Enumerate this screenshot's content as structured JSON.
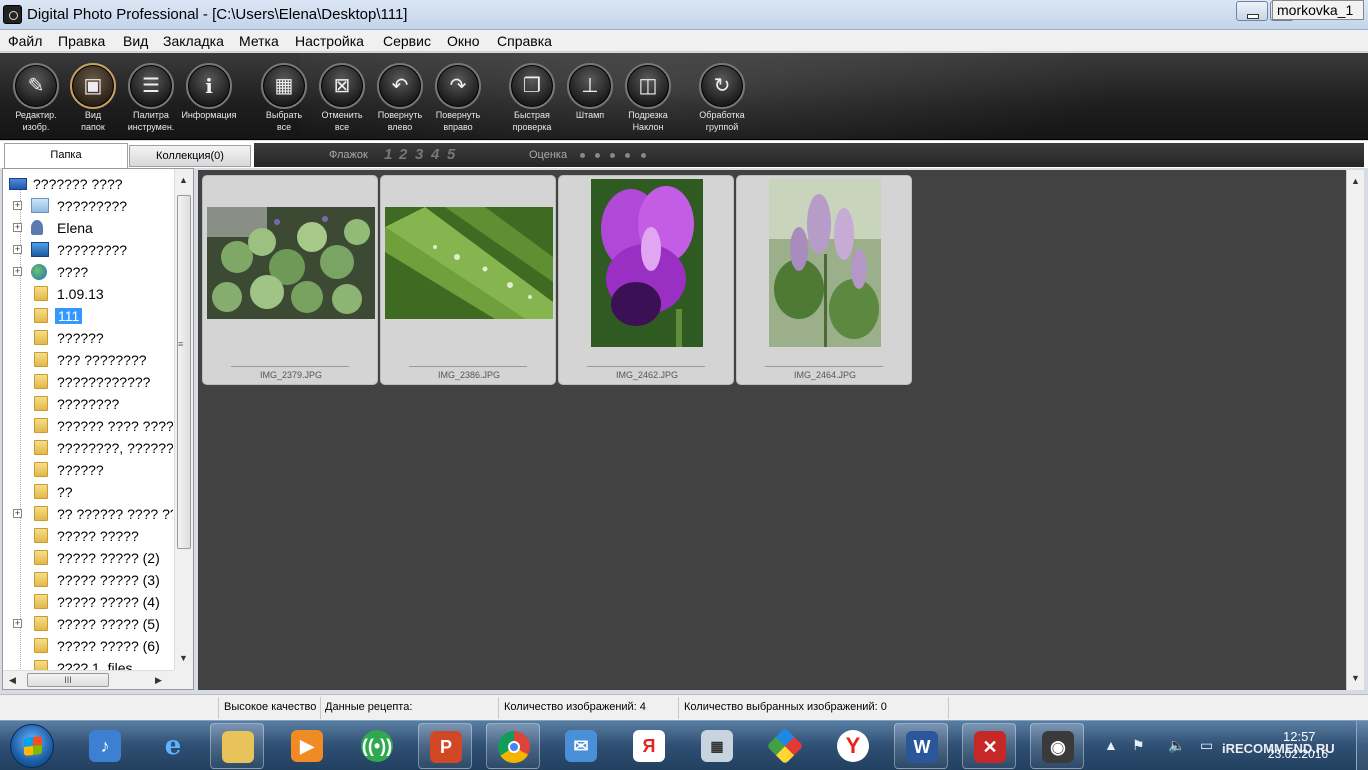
{
  "window": {
    "title": "Digital Photo Professional - [C:\\Users\\Elena\\Desktop\\111]",
    "user_badge": "morkovka_1"
  },
  "menu": [
    "Файл",
    "Правка",
    "Вид",
    "Закладка",
    "Метка",
    "Настройка",
    "Сервис",
    "Окно",
    "Справка"
  ],
  "toolbar": {
    "buttons": [
      {
        "line1": "Редактир.",
        "line2": "изобр.",
        "icon": "edit-image-icon"
      },
      {
        "line1": "Вид",
        "line2": "папок",
        "icon": "folder-view-icon"
      },
      {
        "line1": "Палитра",
        "line2": "инструмен.",
        "icon": "tool-palette-icon"
      },
      {
        "line1": "Информация",
        "line2": "",
        "icon": "info-icon"
      },
      {
        "line1": "Выбрать",
        "line2": "все",
        "icon": "select-all-icon"
      },
      {
        "line1": "Отменить",
        "line2": "все",
        "icon": "deselect-all-icon"
      },
      {
        "line1": "Повернуть",
        "line2": "влево",
        "icon": "rotate-left-icon"
      },
      {
        "line1": "Повернуть",
        "line2": "вправо",
        "icon": "rotate-right-icon"
      },
      {
        "line1": "Быстрая",
        "line2": "проверка",
        "icon": "quick-check-icon"
      },
      {
        "line1": "Штамп",
        "line2": "",
        "icon": "stamp-icon"
      },
      {
        "line1": "Подрезка",
        "line2": "Наклон",
        "icon": "trim-angle-icon"
      },
      {
        "line1": "Обработка",
        "line2": "группой",
        "icon": "batch-process-icon"
      }
    ]
  },
  "tabs": {
    "folder": "Папка",
    "collection": "Коллекция(0)"
  },
  "filter": {
    "flag_label": "Флажок",
    "flags": [
      "1",
      "2",
      "3",
      "4",
      "5"
    ],
    "rating_label": "Оценка"
  },
  "tree": [
    {
      "label": "??????? ????",
      "icon": "computer-icon",
      "expander": false
    },
    {
      "label": "?????????",
      "icon": "library-folder-icon",
      "expander": true
    },
    {
      "label": "Elena",
      "icon": "user-icon",
      "expander": true
    },
    {
      "label": "?????????",
      "icon": "network-icon",
      "expander": true
    },
    {
      "label": "????",
      "icon": "globe-icon",
      "expander": true
    },
    {
      "label": "1.09.13",
      "icon": "folder-icon",
      "expander": false
    },
    {
      "label": "111",
      "icon": "folder-icon",
      "expander": false,
      "selected": true
    },
    {
      "label": "??????",
      "icon": "folder-icon",
      "expander": false
    },
    {
      "label": "??? ????????",
      "icon": "folder-icon",
      "expander": false
    },
    {
      "label": "????????????",
      "icon": "folder-icon",
      "expander": false
    },
    {
      "label": "????????",
      "icon": "folder-icon",
      "expander": false
    },
    {
      "label": "?????? ???? ????._",
      "icon": "folder-icon",
      "expander": false
    },
    {
      "label": "????????, ???????",
      "icon": "folder-icon",
      "expander": false
    },
    {
      "label": "??????",
      "icon": "folder-icon",
      "expander": false
    },
    {
      "label": "??",
      "icon": "folder-icon",
      "expander": false
    },
    {
      "label": "?? ?????? ???? ???",
      "icon": "folder-icon",
      "expander": true
    },
    {
      "label": "????? ?????",
      "icon": "folder-icon",
      "expander": false
    },
    {
      "label": "????? ????? (2)",
      "icon": "folder-icon",
      "expander": false
    },
    {
      "label": "????? ????? (3)",
      "icon": "folder-icon",
      "expander": false
    },
    {
      "label": "????? ????? (4)",
      "icon": "folder-icon",
      "expander": false
    },
    {
      "label": "????? ????? (5)",
      "icon": "folder-icon",
      "expander": true
    },
    {
      "label": "????? ????? (6)",
      "icon": "folder-icon",
      "expander": false
    },
    {
      "label": "???? 1_files",
      "icon": "folder-icon",
      "expander": false
    }
  ],
  "thumbnails": [
    {
      "filename": "IMG_2379.JPG",
      "subject": "green clover leaves"
    },
    {
      "filename": "IMG_2386.JPG",
      "subject": "leaf with water drops"
    },
    {
      "filename": "IMG_2462.JPG",
      "subject": "purple iris"
    },
    {
      "filename": "IMG_2464.JPG",
      "subject": "lilac flowers"
    }
  ],
  "status": {
    "quality": "Высокое качество",
    "recipe": "Данные рецепта:",
    "image_count": "Количество изображений: 4",
    "selected_count": "Количество выбранных изображений: 0"
  },
  "taskbar": {
    "apps": [
      "volume-app-icon",
      "internet-explorer-icon",
      "explorer-icon",
      "media-player-icon",
      "network-app-icon",
      "powerpoint-icon",
      "chrome-icon",
      "mail-icon",
      "yandex-icon",
      "calculator-icon",
      "paint-icon",
      "yandex-browser-icon",
      "word-icon",
      "acrobat-icon",
      "dpp-icon"
    ],
    "time": "12:57",
    "date": "23.02.2016",
    "watermark": "iRECOMMEND.RU"
  },
  "colors": {
    "toolbar_bg": "#1e1e1e",
    "thumb_area_bg": "#424242",
    "selection": "#3399ff",
    "taskbar_bg": "#2f4f74"
  }
}
